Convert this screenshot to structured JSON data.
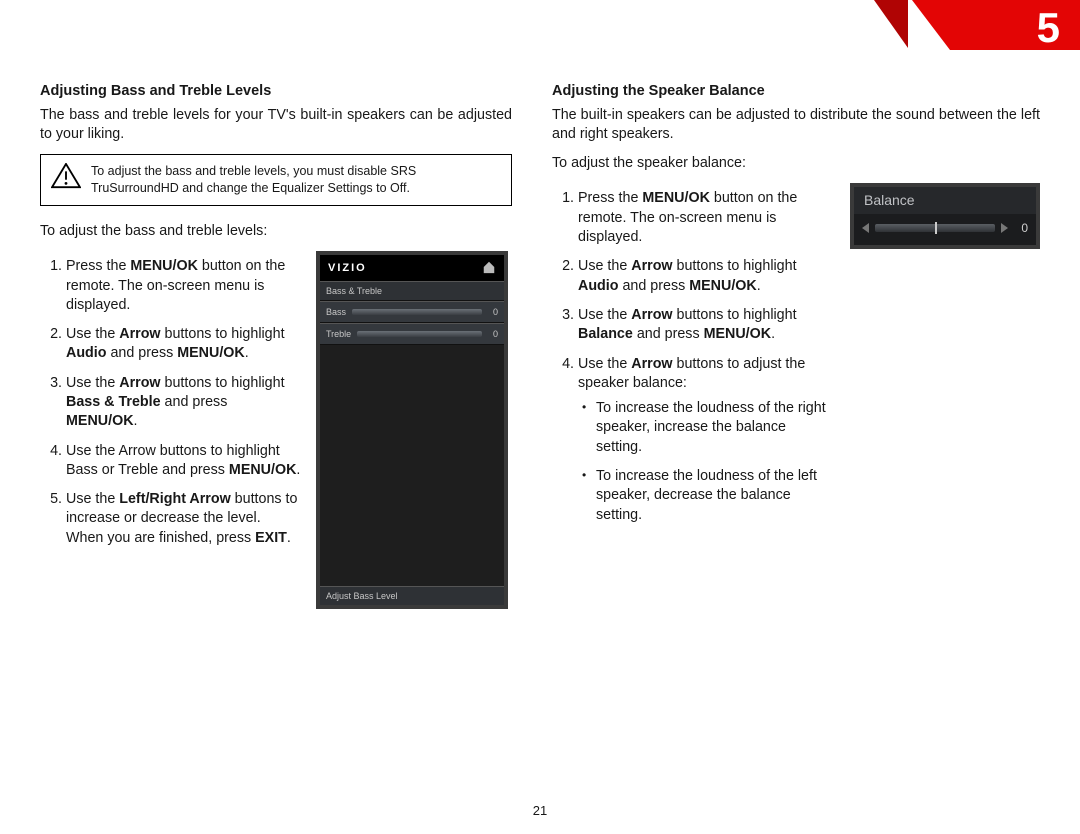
{
  "badge": {
    "number": "5"
  },
  "page_number": "21",
  "left": {
    "heading": "Adjusting Bass and Treble Levels",
    "intro": "The bass and treble levels for your TV's built-in speakers can be adjusted to your liking.",
    "callout": "To adjust the bass and treble levels, you must disable SRS TruSurroundHD and change the Equalizer Settings to Off.",
    "lead": "To adjust the bass and treble levels:",
    "steps": {
      "s1a": "Press the ",
      "s1b": "MENU/OK",
      "s1c": " button on the remote. The on-screen menu is displayed.",
      "s2a": "Use the ",
      "s2b": "Arrow",
      "s2c": " buttons to highlight ",
      "s2d": "Audio",
      "s2e": " and press ",
      "s2f": "MENU/OK",
      "s2g": ".",
      "s3a": "Use the ",
      "s3b": "Arrow",
      "s3c": " buttons to highlight ",
      "s3d": "Bass & Treble",
      "s3e": " and press ",
      "s3f": "MENU/OK",
      "s3g": ".",
      "s4": "Use the Arrow buttons to highlight Bass or Treble and press ",
      "s4b": "MENU/OK",
      "s4c": ".",
      "s5a": "Use the ",
      "s5b": "Left/Right Arrow",
      "s5c": " buttons to increase or decrease the level. When you are finished, press ",
      "s5d": "EXIT",
      "s5e": "."
    },
    "screenshot": {
      "brand": "VIZIO",
      "breadcrumb": "Bass & Treble",
      "row1_label": "Bass",
      "row1_value": "0",
      "row2_label": "Treble",
      "row2_value": "0",
      "help": "Adjust Bass Level"
    }
  },
  "right": {
    "heading": "Adjusting the Speaker Balance",
    "intro": "The built-in speakers can be adjusted to distribute the sound between the left and right speakers.",
    "lead": "To adjust the speaker balance:",
    "steps": {
      "s1a": "Press the ",
      "s1b": "MENU/OK",
      "s1c": " button on the remote. The on-screen menu is displayed.",
      "s2a": "Use the ",
      "s2b": "Arrow",
      "s2c": " buttons to highlight ",
      "s2d": "Audio",
      "s2e": " and press ",
      "s2f": "MENU/OK",
      "s2g": ".",
      "s3a": "Use the ",
      "s3b": "Arrow",
      "s3c": " buttons to highlight ",
      "s3d": "Balance",
      "s3e": " and press ",
      "s3f": "MENU/OK",
      "s3g": ".",
      "s4a": "Use the ",
      "s4b": "Arrow",
      "s4c": " buttons to adjust the speaker balance:",
      "b1": "To increase the loudness of the right speaker, increase the balance setting.",
      "b2": "To increase the loudness of the left speaker, decrease the balance setting."
    },
    "screenshot": {
      "title": "Balance",
      "value": "0"
    }
  }
}
